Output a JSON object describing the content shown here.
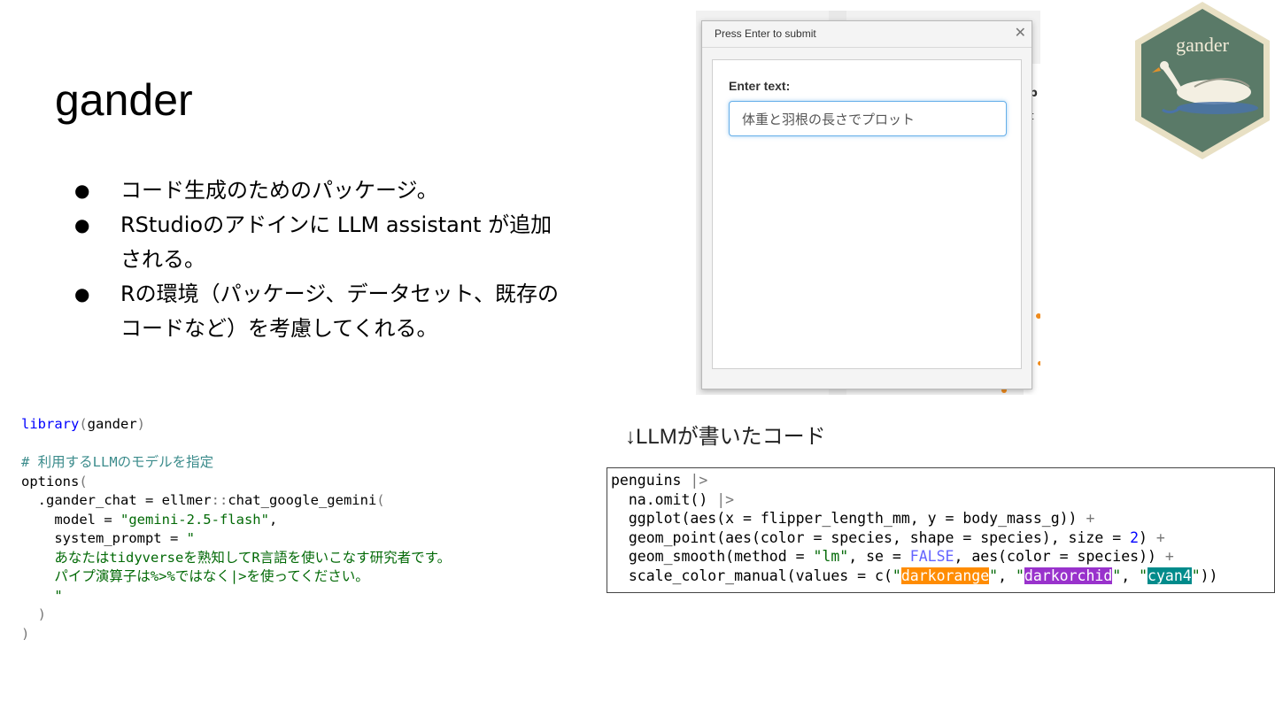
{
  "slide": {
    "title": "gander",
    "bullets": [
      {
        "line1": "コード生成のためのパッケージ。",
        "line2": ""
      },
      {
        "line1": "RStudioのアドインに LLM assistant が追加",
        "line2": "される。"
      },
      {
        "line1": "Rの環境（パッケージ、データセット、既存の",
        "line2": "コードなど）を考慮してくれる。"
      }
    ],
    "bullet_glyph": "●",
    "caption": "↓LLMが書いたコード"
  },
  "dialog": {
    "title": "Press Enter to submit",
    "close_glyph": "✕",
    "label": "Enter text:",
    "input_value": "体重と羽根の長さでプロット",
    "background_fragment_1": "lp",
    "background_fragment_2": "rt"
  },
  "logo": {
    "text": "gander",
    "fill": "#5a7a68",
    "border": "#e8e0c4"
  },
  "code_left": {
    "lines": [
      [
        [
          "fn",
          "library"
        ],
        [
          "par",
          "("
        ],
        [
          "txt",
          "gander"
        ],
        [
          "par",
          ")"
        ]
      ],
      [],
      [
        [
          "cmt",
          "# 利用するLLMのモデルを指定"
        ]
      ],
      [
        [
          "txt",
          "options"
        ],
        [
          "par",
          "("
        ]
      ],
      [
        [
          "txt",
          "  .gander_chat = ellmer"
        ],
        [
          "par",
          "::"
        ],
        [
          "txt",
          "chat_google_gemini"
        ],
        [
          "par",
          "("
        ]
      ],
      [
        [
          "txt",
          "    model = "
        ],
        [
          "str",
          "\"gemini-2.5-flash\""
        ],
        [
          "txt",
          ","
        ]
      ],
      [
        [
          "txt",
          "    system_prompt = "
        ],
        [
          "str",
          "\""
        ]
      ],
      [
        [
          "str",
          "    あなたはtidyverseを熟知してR言語を使いこなす研究者です。"
        ]
      ],
      [
        [
          "str",
          "    パイプ演算子は%>%ではなく|>を使ってください。"
        ]
      ],
      [
        [
          "str",
          "    \""
        ]
      ],
      [
        [
          "txt",
          "  "
        ],
        [
          "par",
          ")"
        ]
      ],
      [
        [
          "par",
          ")"
        ]
      ]
    ]
  },
  "code_right": {
    "lines": [
      [
        [
          "txt",
          "penguins "
        ],
        [
          "pipe",
          "|>"
        ]
      ],
      [
        [
          "txt",
          "  na.omit() "
        ],
        [
          "pipe",
          "|>"
        ]
      ],
      [
        [
          "txt",
          "  ggplot(aes(x = flipper_length_mm, y = body_mass_g)) "
        ],
        [
          "pipe",
          "+"
        ]
      ],
      [
        [
          "txt",
          "  geom_point(aes(color = species, shape = species), size = "
        ],
        [
          "num",
          "2"
        ],
        [
          "txt",
          ") "
        ],
        [
          "pipe",
          "+"
        ]
      ],
      [
        [
          "txt",
          "  geom_smooth(method = "
        ],
        [
          "str",
          "\"lm\""
        ],
        [
          "txt",
          ", se = "
        ],
        [
          "bool",
          "FALSE"
        ],
        [
          "txt",
          ", aes(color = species)) "
        ],
        [
          "pipe",
          "+"
        ]
      ],
      [
        [
          "txt",
          "  scale_color_manual(values = c("
        ],
        [
          "str",
          "\""
        ],
        [
          "hl1",
          "darkorange"
        ],
        [
          "str",
          "\""
        ],
        [
          "txt",
          ", "
        ],
        [
          "str",
          "\""
        ],
        [
          "hl2",
          "darkorchid"
        ],
        [
          "str",
          "\""
        ],
        [
          "txt",
          ", "
        ],
        [
          "str",
          "\""
        ],
        [
          "hl3",
          "cyan4"
        ],
        [
          "str",
          "\""
        ],
        [
          "txt",
          "))"
        ]
      ]
    ],
    "swatches": {
      "hl1": "#ff8c00",
      "hl2": "#9932cc",
      "hl3": "#008b8b"
    }
  }
}
